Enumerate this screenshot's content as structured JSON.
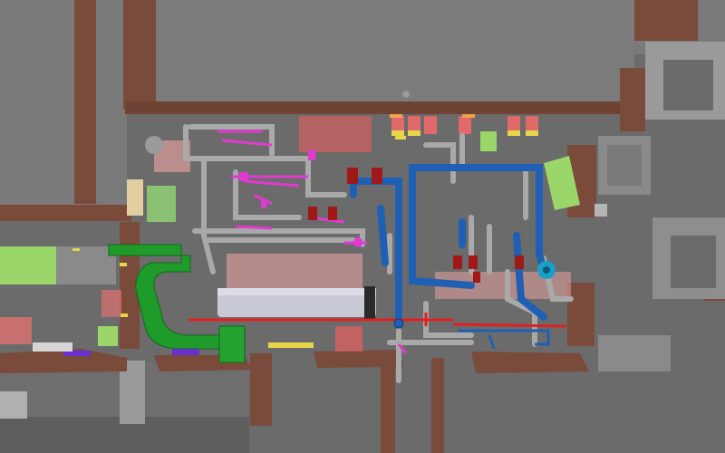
{
  "viewport": {
    "kind": "3d-plant-model-view",
    "background_color": "#6b6b6b"
  },
  "legend_colors": {
    "structure_brown": "#7a4a3a",
    "wall_gray": "#8c8c8c",
    "pipe_gray": "#a9a9a9",
    "pipe_blue": "#1f5fb4",
    "pipe_red": "#e02020",
    "pipe_magenta": "#e03ad0",
    "duct_green": "#1f9b2a",
    "tank_light": "#c9c9d6",
    "equipment_red": "#a01818",
    "zone_pink": "#e8a0a0",
    "zone_green": "#9ad66a",
    "accent_orange": "#f2a24a",
    "accent_yellow": "#e8d64a",
    "accent_purple": "#6a2fd0",
    "accent_cyan": "#1aa0c8"
  },
  "icons": [
    "equipment-pump-icon",
    "valve-icon",
    "tank-icon"
  ]
}
